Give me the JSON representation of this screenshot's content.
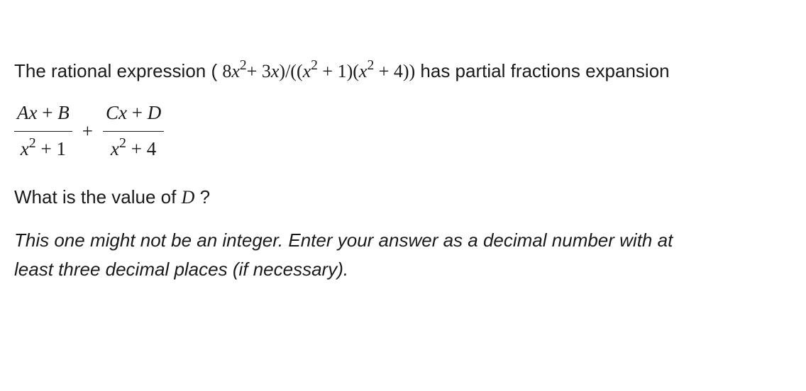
{
  "problem": {
    "intro_pre": "The rational expression ( ",
    "expr_num_coef1": "8",
    "expr_num_var1": "x",
    "expr_num_pow1": "2",
    "expr_num_plus": "+ ",
    "expr_num_coef2": "3",
    "expr_num_var2": "x",
    "expr_num_close": ")",
    "slash": "/",
    "den_open": "((",
    "den_var1": "x",
    "den_pow1": "2",
    "den_mid1": " + 1)(",
    "den_var2": "x",
    "den_pow2": "2",
    "den_mid2": " + 4))",
    "intro_post": " has partial fractions expansion"
  },
  "fractions": {
    "f1_num_Ax": "Ax",
    "f1_num_plus": " + ",
    "f1_num_B": "B",
    "f1_den_x": "x",
    "f1_den_pow": "2",
    "f1_den_rest": " + 1",
    "plus": "+",
    "f2_num_Cx": "Cx",
    "f2_num_plus": " + ",
    "f2_num_D": "D",
    "f2_den_x": "x",
    "f2_den_pow": "2",
    "f2_den_rest": " + 4"
  },
  "question": {
    "pre": "What is the value of ",
    "var": "D",
    "post": " ?"
  },
  "hint": {
    "line1_pre": "This one might not be an integer. Enter your answer as a decimal number with at",
    "line2": "least three decimal places (if necessary)."
  }
}
